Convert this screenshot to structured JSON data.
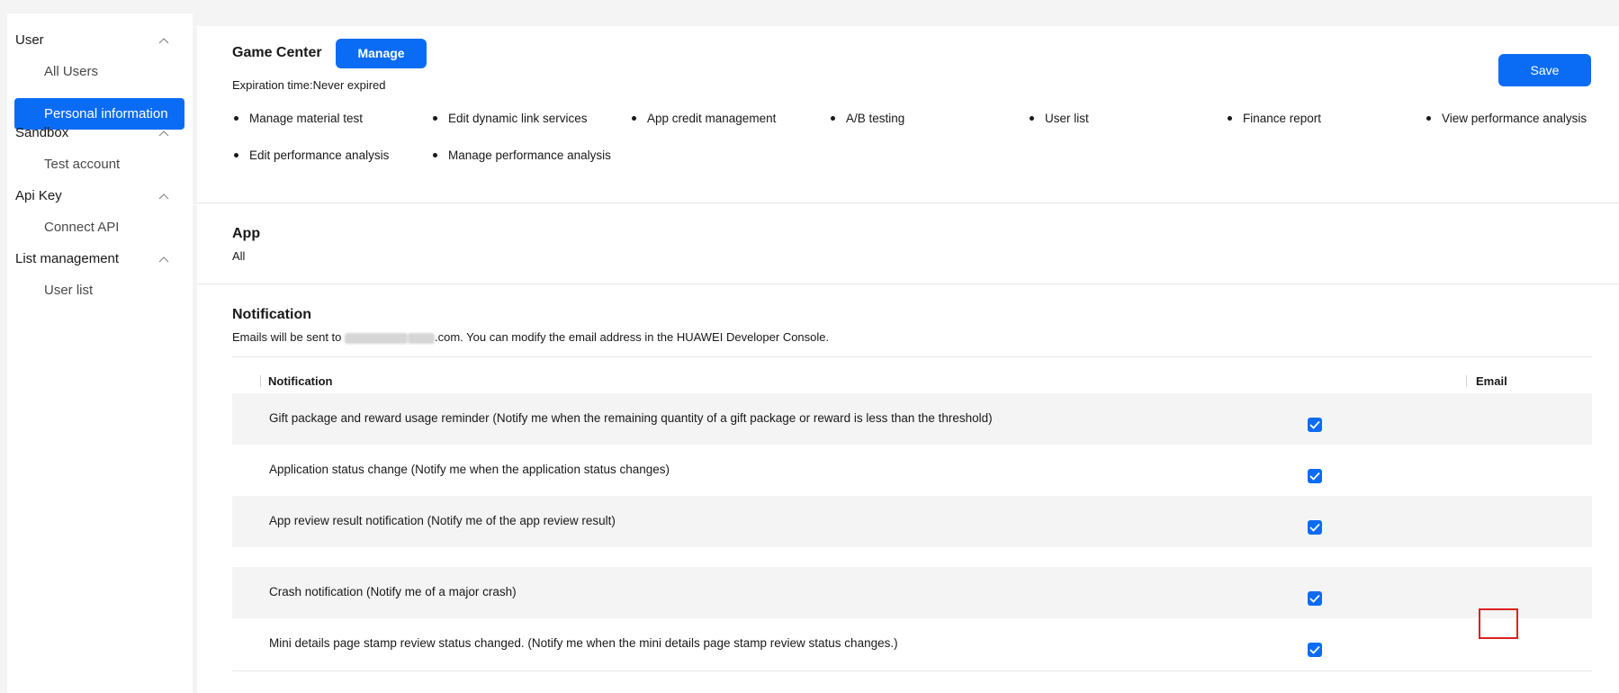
{
  "sidebar": {
    "groups": [
      {
        "label": "User",
        "items": [
          "All Users",
          "Personal information"
        ]
      },
      {
        "label": "Sandbox",
        "items": [
          "Test account"
        ]
      },
      {
        "label": "Api Key",
        "items": [
          "Connect API"
        ]
      },
      {
        "label": "List management",
        "items": [
          "User list"
        ]
      }
    ],
    "active_item": "Personal information"
  },
  "game_center": {
    "title": "Game Center",
    "manage_label": "Manage",
    "expiration": "Expiration time:Never expired",
    "save_label": "Save",
    "permissions": [
      "Manage material test",
      "Edit dynamic link services",
      "App credit management",
      "A/B testing",
      "User list",
      "Finance report",
      "View performance analysis",
      "Edit performance analysis",
      "Manage performance analysis"
    ]
  },
  "app": {
    "title": "App",
    "value": "All"
  },
  "notification": {
    "title": "Notification",
    "desc_prefix": "Emails will be sent to ",
    "desc_suffix": ".com. You can modify the email address in the HUAWEI Developer Console.",
    "columns": [
      "Notification",
      "Email"
    ],
    "rows": [
      {
        "text": "Gift package and reward usage reminder (Notify me when the remaining quantity of a gift package or reward is less than the threshold)",
        "email": true
      },
      {
        "text": "Application status change (Notify me when the application status changes)",
        "email": true
      },
      {
        "text": "App review result notification (Notify me of the app review result)",
        "email": true
      },
      {
        "text": "Crash notification (Notify me of a major crash)",
        "email": true
      },
      {
        "text": "Mini details page stamp review status changed. (Notify me when the mini details page stamp review status changes.)",
        "email": true
      }
    ]
  },
  "colors": {
    "accent": "#0a6cf5",
    "highlight": "#e02020"
  }
}
